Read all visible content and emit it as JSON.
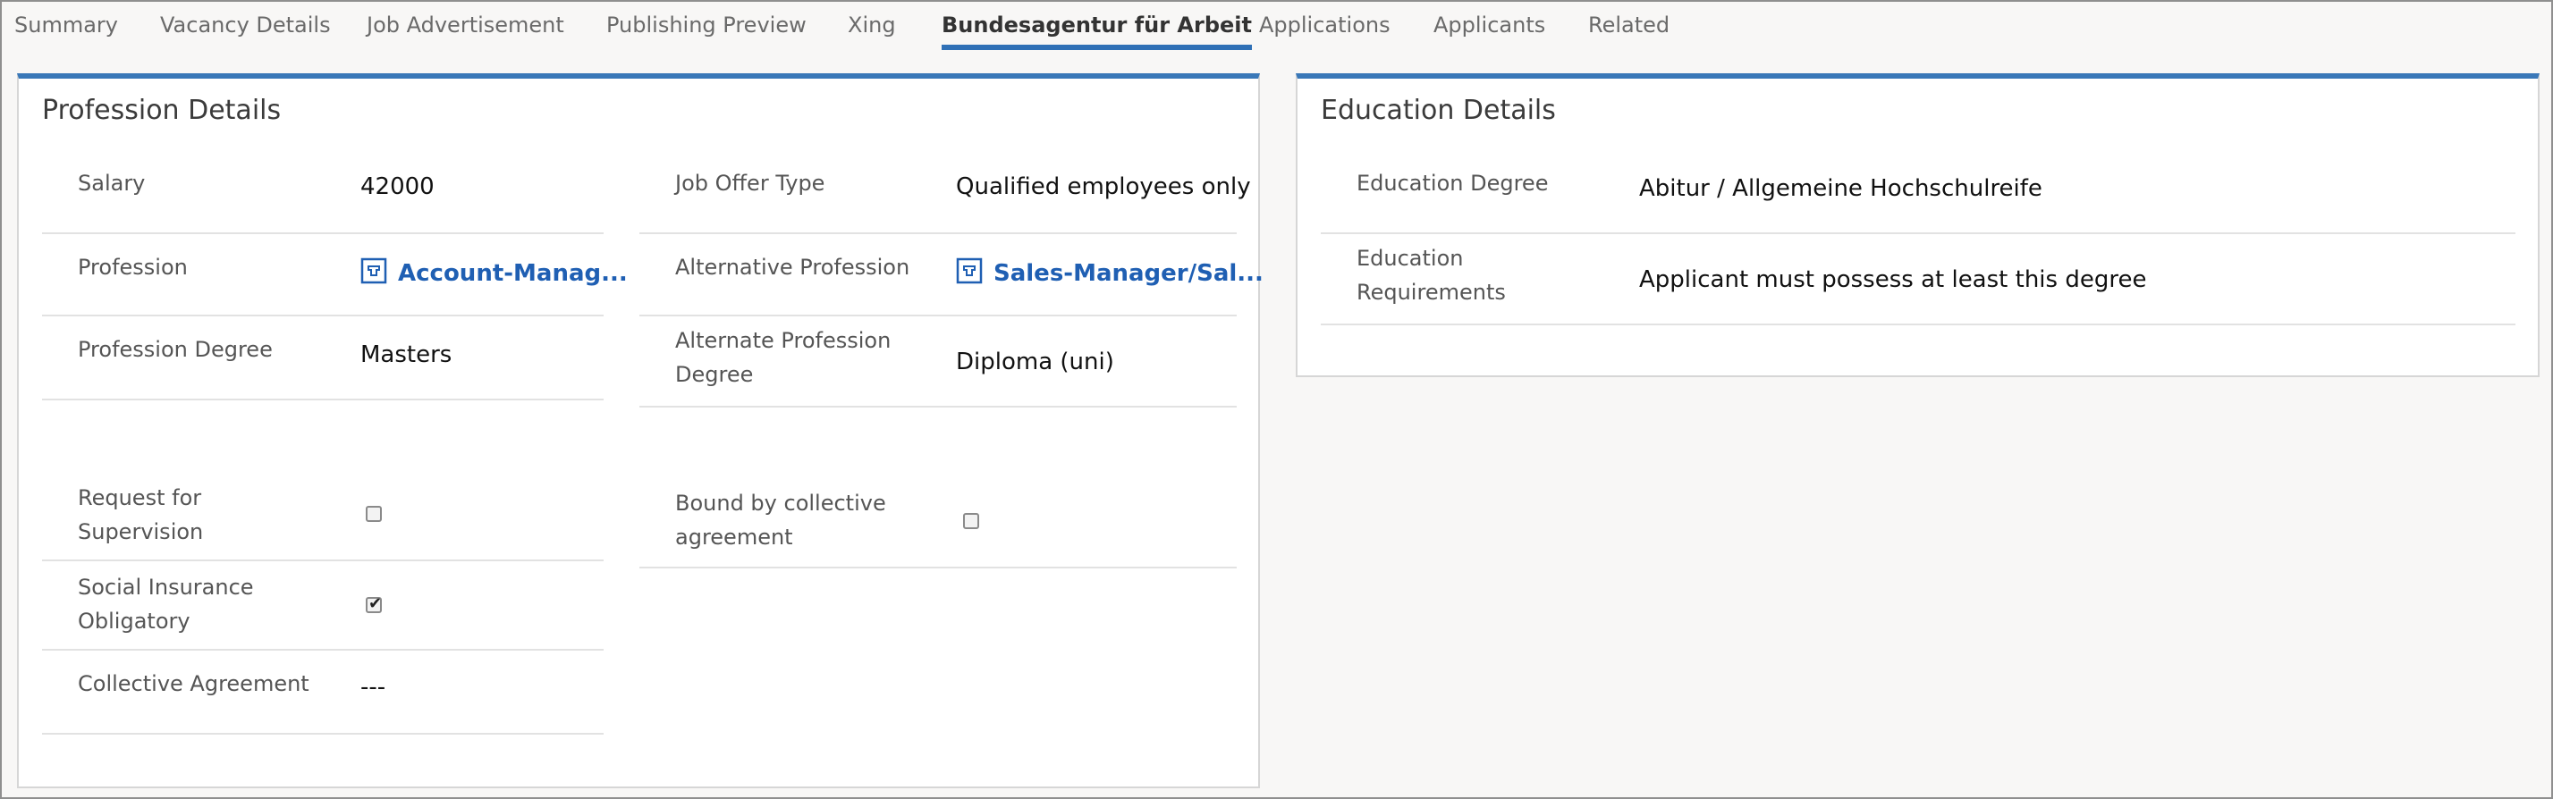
{
  "tabs": [
    {
      "label": "Summary",
      "active": false
    },
    {
      "label": "Vacancy Details",
      "active": false
    },
    {
      "label": "Job Advertisement",
      "active": false
    },
    {
      "label": "Publishing Preview",
      "active": false
    },
    {
      "label": "Xing",
      "active": false
    },
    {
      "label": "Bundesagentur für Arbeit",
      "active": true
    },
    {
      "label": "Applications",
      "active": false
    },
    {
      "label": "Applicants",
      "active": false
    },
    {
      "label": "Related",
      "active": false
    }
  ],
  "profession_details": {
    "title": "Profession Details",
    "salary_label": "Salary",
    "salary_value": "42000",
    "job_offer_type_label": "Job Offer Type",
    "job_offer_type_value": "Qualified employees only",
    "profession_label": "Profession",
    "profession_value": "Account-Manag...",
    "alt_profession_label": "Alternative Profession",
    "alt_profession_value": "Sales-Manager/Sal...",
    "profession_degree_label": "Profession Degree",
    "profession_degree_value": "Masters",
    "alt_profession_degree_label_1": "Alternate Profession",
    "alt_profession_degree_label_2": "Degree",
    "alt_profession_degree_value": "Diploma (uni)",
    "request_supervision_label_1": "Request for",
    "request_supervision_label_2": "Supervision",
    "request_supervision_checked": false,
    "bound_collective_label_1": "Bound by collective",
    "bound_collective_label_2": "agreement",
    "bound_collective_checked": false,
    "social_insurance_label_1": "Social Insurance",
    "social_insurance_label_2": "Obligatory",
    "social_insurance_checked": true,
    "collective_agreement_label": "Collective Agreement",
    "collective_agreement_value": "---"
  },
  "education_details": {
    "title": "Education Details",
    "education_degree_label": "Education Degree",
    "education_degree_value": "Abitur / Allgemeine Hochschulreife",
    "education_requirements_label_1": "Education",
    "education_requirements_label_2": "Requirements",
    "education_requirements_value": "Applicant must possess at least this degree"
  },
  "colors": {
    "accent": "#2f70b6",
    "link": "#1f5fb3",
    "background": "#f8f7f6"
  },
  "icons": {
    "entity_lookup": "entity-icon"
  }
}
